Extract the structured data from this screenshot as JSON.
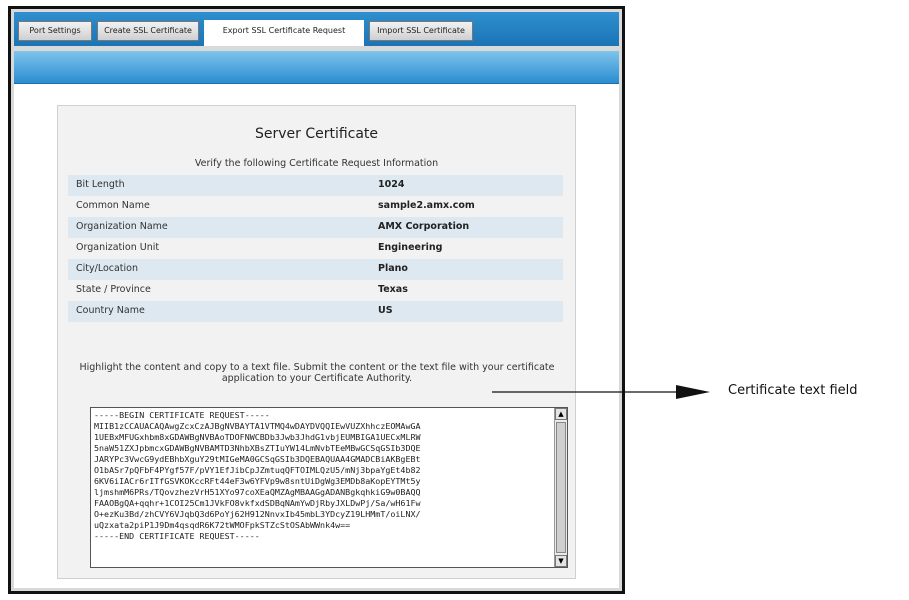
{
  "tabs": [
    {
      "label": "Port Settings"
    },
    {
      "label": "Create SSL Certificate"
    },
    {
      "label": "Export SSL Certificate Request"
    },
    {
      "label": "Import SSL Certificate"
    }
  ],
  "panel": {
    "title": "Server Certificate",
    "subtitle": "Verify the following Certificate Request Information",
    "fields": [
      {
        "label": "Bit Length",
        "value": "1024"
      },
      {
        "label": "Common Name",
        "value": "sample2.amx.com"
      },
      {
        "label": "Organization Name",
        "value": "AMX Corporation"
      },
      {
        "label": "Organization Unit",
        "value": "Engineering"
      },
      {
        "label": "City/Location",
        "value": "Plano"
      },
      {
        "label": "State / Province",
        "value": "Texas"
      },
      {
        "label": "Country Name",
        "value": "US"
      }
    ],
    "instructions": "Highlight the content and copy to a text file. Submit the content or the text file with your certificate application to your Certificate Authority.",
    "certificate_text": "-----BEGIN CERTIFICATE REQUEST-----\nMIIB1zCCAUACAQAwgZcxCzAJBgNVBAYTA1VTMQ4wDAYDVQQIEwVUZXhhczEOMAwGA\n1UEBxMFUGxhbm8xGDAWBgNVBAoTDOFNWCBDb3Jwb3JhdG1vbjEUMBIGA1UECxMLRW\n5naW51ZXJpbmcxGDAWBgNVBAMTD3NhbXBsZTIuYW14LmNvbTEeMBwGCSqGSIb3DQE\nJARYPc3VwcG9ydEBhbXguY29tMIGeMA0GCSqGSIb3DQEBAQUAA4GMADCBiAKBgEBt\nO1bASr7pQFbF4PYgf57F/pVY1EfJibCpJZmtuqQFTOIMLQzU5/mNj3bpaYgEt4b82\n6KV6iIACr6rITfGSVKOKccRFt44eF3w6YFVp9w8sntUiDgWg3EMDb8aKopEYTMt5y\nljmshmM6PRs/TQovzhezVrH51XYo97coXEaQMZAgMBAAGgADANBgkqhkiG9w0BAQQ\nFAAOBgQA+qqhr+1COI25Cm1JVkFO8vkfxdSDBqNAmYwDjRbyJXLDwPj/Sa/wH61Fw\nO+ezKu3Bd/zhCVY6VJqbQ3d6PoYj62H912NnvxIb45mbL3YDcyZ19LHMmT/oiLNX/\nuQzxata2piP1J9Dm4qsqdR6K72tWMOFpkSTZcStOSAbWWnk4w==\n-----END CERTIFICATE REQUEST-----"
  },
  "annotation": {
    "label": "Certificate text field"
  }
}
